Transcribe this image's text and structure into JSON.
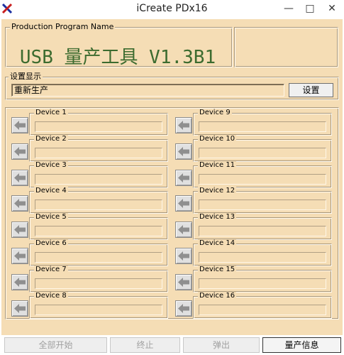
{
  "window": {
    "title": "iCreate PDx16",
    "minimize_glyph": "—",
    "restore_glyph": "□",
    "close_glyph": "✕"
  },
  "program": {
    "group_label": "Production Program Name",
    "name": "USB 量产工具 V1.3B1"
  },
  "settings": {
    "group_label": "设置显示",
    "display_value": "重新生产",
    "button_label": "设置"
  },
  "devices": [
    {
      "label": "Device 1"
    },
    {
      "label": "Device 2"
    },
    {
      "label": "Device 3"
    },
    {
      "label": "Device 4"
    },
    {
      "label": "Device 5"
    },
    {
      "label": "Device 6"
    },
    {
      "label": "Device 7"
    },
    {
      "label": "Device 8"
    },
    {
      "label": "Device 9"
    },
    {
      "label": "Device 10"
    },
    {
      "label": "Device 11"
    },
    {
      "label": "Device 12"
    },
    {
      "label": "Device 13"
    },
    {
      "label": "Device 14"
    },
    {
      "label": "Device 15"
    },
    {
      "label": "Device 16"
    }
  ],
  "actions": {
    "start_all": "全部开始",
    "stop": "终止",
    "eject": "弹出",
    "production_info": "量产信息"
  },
  "colors": {
    "panel_bg": "#f5ddb5",
    "title_green": "#3c6b2f"
  }
}
